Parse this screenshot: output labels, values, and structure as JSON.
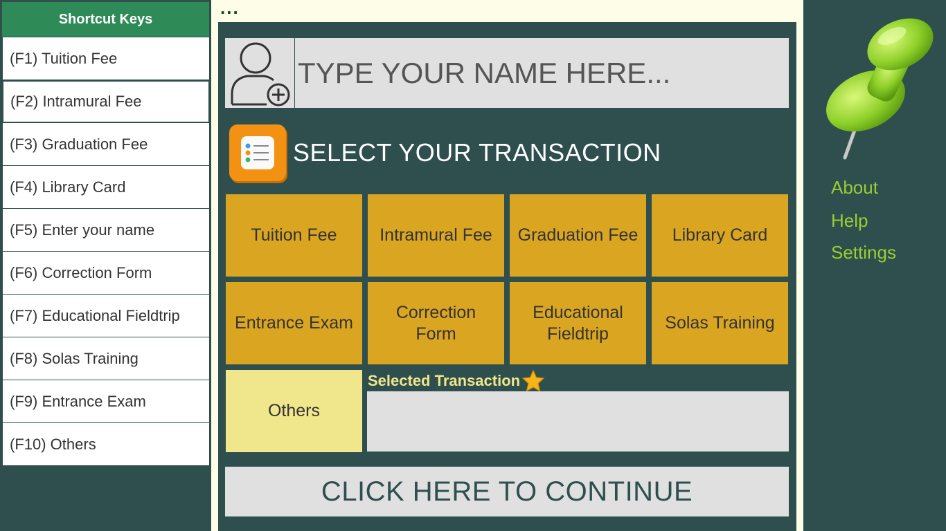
{
  "shortcuts": {
    "header": "Shortcut Keys",
    "items": [
      "(F1) Tuition Fee",
      "(F2) Intramural Fee",
      "(F3) Graduation Fee",
      "(F4) Library Card",
      "(F5) Enter your name",
      "(F6) Correction Form",
      "(F7) Educational Fieldtrip",
      "(F8) Solas Training",
      "(F9) Entrance Exam",
      "(F10) Others"
    ]
  },
  "top_dots": "...",
  "name": {
    "placeholder": "TYPE YOUR NAME HERE...",
    "value": ""
  },
  "select_title": "SELECT YOUR TRANSACTION",
  "transactions": [
    "Tuition Fee",
    "Intramural Fee",
    "Graduation Fee",
    "Library Card",
    "Entrance Exam",
    "Correction Form",
    "Educational Fieldtrip",
    "Solas Training",
    "Others"
  ],
  "selected": {
    "label": "Selected Transaction",
    "value": ""
  },
  "continue_label": "CLICK HERE TO CONTINUE",
  "right_links": {
    "about": "About",
    "help": "Help",
    "settings": "Settings"
  },
  "colors": {
    "panel": "#2f4f4f",
    "header_green": "#2e8b57",
    "tile_gold": "#daa520",
    "tile_khaki": "#f0e68c",
    "link_green": "#9acd32",
    "box_gray": "#e0e0e0"
  },
  "icons": [
    "user-add-icon",
    "checklist-app-icon",
    "star-icon",
    "pushpin-icon"
  ]
}
